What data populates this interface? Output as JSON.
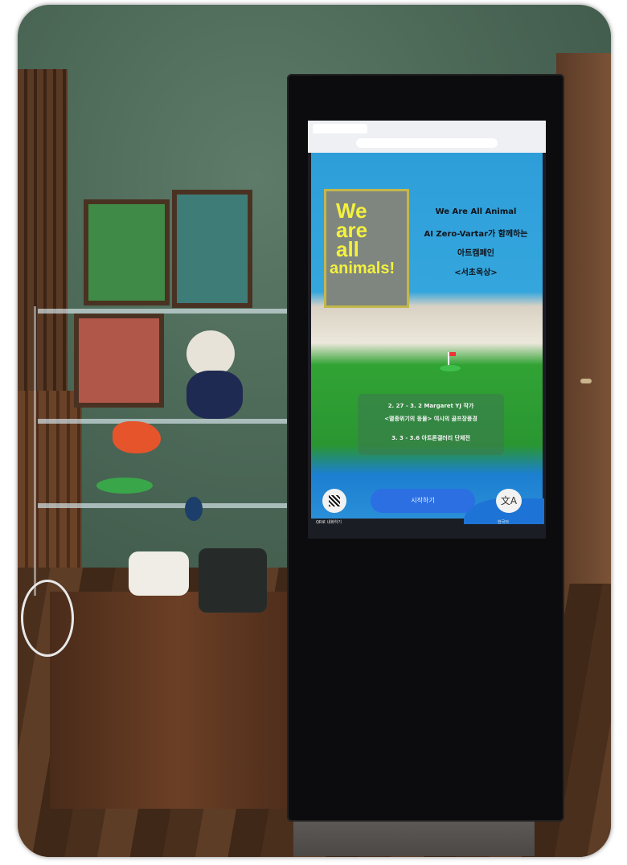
{
  "scene": {
    "description_label": ""
  },
  "kiosk": {
    "browser": {
      "tab_label": "",
      "url": ""
    },
    "poster": {
      "line1": "We",
      "line2": "are",
      "line3": "all",
      "line4": "animals!"
    },
    "headline": {
      "title": "We Are All Animal",
      "line2": "AI Zero-Vartar가 함께하는",
      "line3": "아트캠페인",
      "line4": "<서초옥상>"
    },
    "info": {
      "line1": "2. 27 - 3. 2 Margaret YJ 작가",
      "line2": "<멸종위기의 동물> 여시의 골프장풍경",
      "line3": "3. 3 - 3.6 아트론갤러리 단체전"
    },
    "start_button": "시작하기",
    "qr_label": "QR로 내화하기",
    "lang_label": "한국어",
    "translate_icon": "文A"
  },
  "colors": {
    "sky": "#34a6dd",
    "grass": "#2a9632",
    "button": "#2b6fe3",
    "poster_text": "#f4f13e"
  }
}
